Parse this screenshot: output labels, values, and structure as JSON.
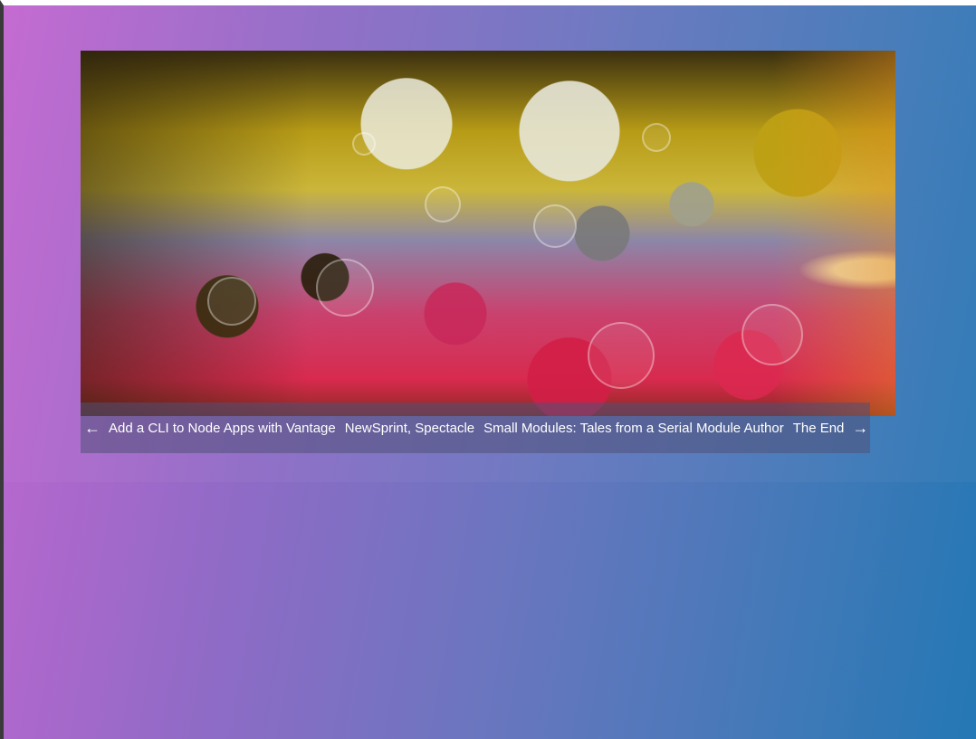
{
  "hero": {
    "image_icon": "abstract-oil-water-bubbles-image"
  },
  "nav": {
    "prev_icon": "left-arrow-icon",
    "prev_glyph": "←",
    "next_icon": "right-arrow-icon",
    "next_glyph": "→",
    "links": [
      {
        "label": "Add a CLI to Node Apps with Vantage"
      },
      {
        "label": "NewSprint, Spectacle"
      },
      {
        "label": "Small Modules: Tales from a Serial Module Author"
      },
      {
        "label": "The End"
      }
    ]
  },
  "colors": {
    "gradient_start": "#c266d0",
    "gradient_end": "#2478b5",
    "nav_bar": "#50507a",
    "nav_text": "#ffffff"
  }
}
